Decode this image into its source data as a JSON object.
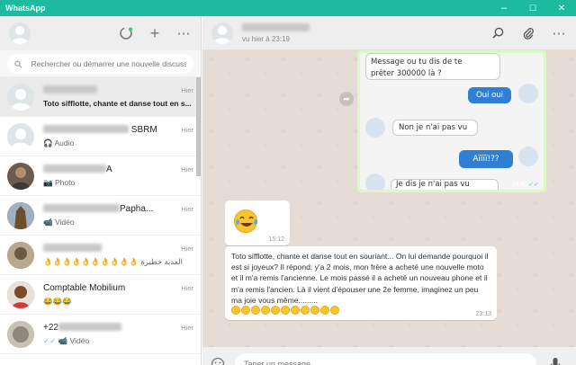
{
  "app": {
    "title": "WhatsApp"
  },
  "window_controls": {
    "minimize": "–",
    "maximize": "☐",
    "close": "✕"
  },
  "left_header": {
    "new_chat_icon": "+",
    "menu_icon": "⋯"
  },
  "search": {
    "placeholder": "Rechercher ou démarrer une nouvelle discussi..."
  },
  "chats": [
    {
      "name": "",
      "time": "Hier",
      "preview": "Toto sifflotte, chante et danse tout en s...",
      "avatar_color": "#dfe5e7"
    },
    {
      "name": "SBRM",
      "time": "Hier",
      "preview": "Audio",
      "preview_icon": "headphones-icon",
      "avatar_color": "#dfe5e7"
    },
    {
      "name": "A",
      "time": "Hier",
      "preview": "Photo",
      "preview_icon": "camera-icon",
      "avatar_color": "#6b5c4e"
    },
    {
      "name": "Papha...",
      "time": "Hier",
      "preview": "Vidéo",
      "preview_icon": "video-icon",
      "avatar_color": "#8a7a5a"
    },
    {
      "name": "",
      "time": "Hier",
      "preview": "👌👌👌👌👌👌👌👌👌👌 العدبة خطيرة",
      "avatar_color": "#a09070"
    },
    {
      "name": "Comptable Mobilium",
      "time": "Hier",
      "preview": "😂😂😂",
      "avatar_color": "#8c5a3c"
    },
    {
      "name": "+22",
      "time": "Hier",
      "preview": "Vidéo",
      "preview_icon": "video-icon",
      "avatar_color": "#b8b2a6"
    }
  ],
  "conversation_header": {
    "name": "",
    "status": "vu hier à 23:19"
  },
  "image_message": {
    "lines": [
      "Message ou tu dis de te",
      "prêter 300000 là ?",
      "Oui oui",
      "Non je n'ai pas vu",
      "Aïïïï!??",
      "Je dis je n'ai pas vu"
    ],
    "time": "14:42"
  },
  "emoji_message": {
    "time": "15:12"
  },
  "text_message": {
    "text": "Toto sifflotte, chante et danse tout en souriant... On lui demande pourquoi il est si joyeux? Il répond: y'a 2 mois,  mon frère a acheté une nouvelle moto et il m'a remis l'ancienne. Le mois passé il a acheté un nouveau  phone et il m'a remis l'ancien. Là il vient d'épouser une 2e femme, imaginez un peu ma joie vous même.........",
    "time": "23:13"
  },
  "composer": {
    "placeholder": "Taper un message"
  },
  "colors": {
    "brand": "#1dba9f",
    "wallpaper": "#e5ddd5",
    "outgoing": "#dcf8c6"
  }
}
